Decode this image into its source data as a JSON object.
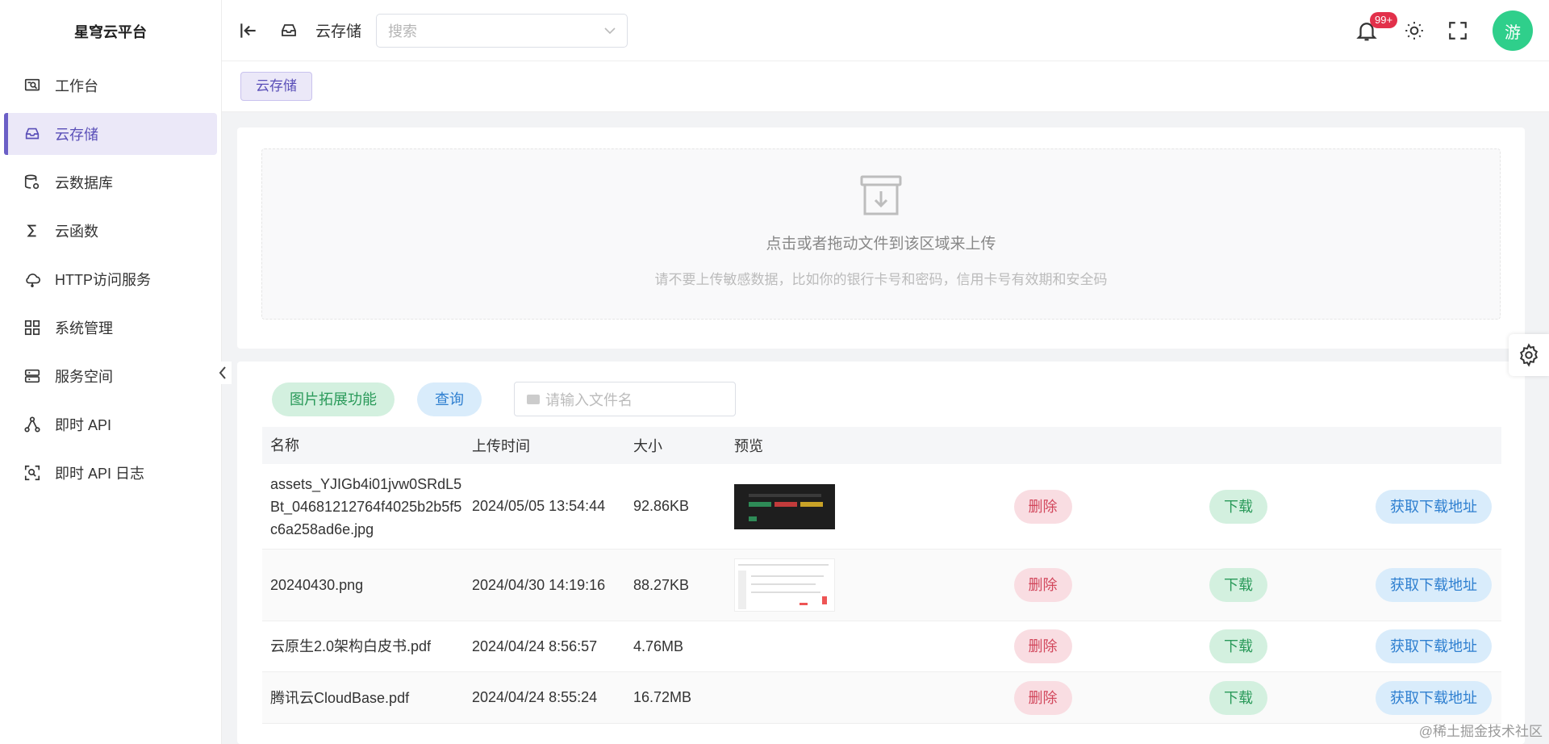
{
  "app": {
    "title": "星穹云平台"
  },
  "sidebar": {
    "items": [
      {
        "label": "工作台",
        "icon": "workbench-icon"
      },
      {
        "label": "云存储",
        "icon": "storage-icon",
        "active": true
      },
      {
        "label": "云数据库",
        "icon": "database-icon"
      },
      {
        "label": "云函数",
        "icon": "function-icon"
      },
      {
        "label": "HTTP访问服务",
        "icon": "cloud-icon"
      },
      {
        "label": "系统管理",
        "icon": "grid-icon"
      },
      {
        "label": "服务空间",
        "icon": "server-icon"
      },
      {
        "label": "即时 API",
        "icon": "api-icon"
      },
      {
        "label": "即时 API 日志",
        "icon": "log-icon"
      }
    ]
  },
  "header": {
    "title": "云存储",
    "search_placeholder": "搜索",
    "notification_badge": "99+",
    "avatar_text": "游"
  },
  "tabs": [
    {
      "label": "云存储",
      "active": true
    }
  ],
  "upload": {
    "main_text": "点击或者拖动文件到该区域来上传",
    "sub_text": "请不要上传敏感数据，比如你的银行卡号和密码，信用卡号有效期和安全码"
  },
  "toolbar": {
    "image_ext_label": "图片拓展功能",
    "query_label": "查询",
    "filename_placeholder": "请输入文件名"
  },
  "table": {
    "headers": {
      "name": "名称",
      "time": "上传时间",
      "size": "大小",
      "preview": "预览"
    },
    "actions": {
      "delete": "删除",
      "download": "下载",
      "get_url": "获取下载地址"
    },
    "rows": [
      {
        "name": "assets_YJIGb4i01jvw0SRdL5Bt_04681212764f4025b2b5f5c6a258ad6e.jpg",
        "time": "2024/05/05 13:54:44",
        "size": "92.86KB",
        "preview": "dark"
      },
      {
        "name": "20240430.png",
        "time": "2024/04/30 14:19:16",
        "size": "88.27KB",
        "preview": "light"
      },
      {
        "name": "云原生2.0架构白皮书.pdf",
        "time": "2024/04/24 8:56:57",
        "size": "4.76MB",
        "preview": "none"
      },
      {
        "name": "腾讯云CloudBase.pdf",
        "time": "2024/04/24 8:55:24",
        "size": "16.72MB",
        "preview": "none"
      }
    ]
  },
  "watermark": "@稀土掘金技术社区",
  "colors": {
    "accent": "#6b5fc6",
    "green": "#2a9a5a",
    "red": "#d2465b",
    "blue": "#2e7fd0"
  }
}
